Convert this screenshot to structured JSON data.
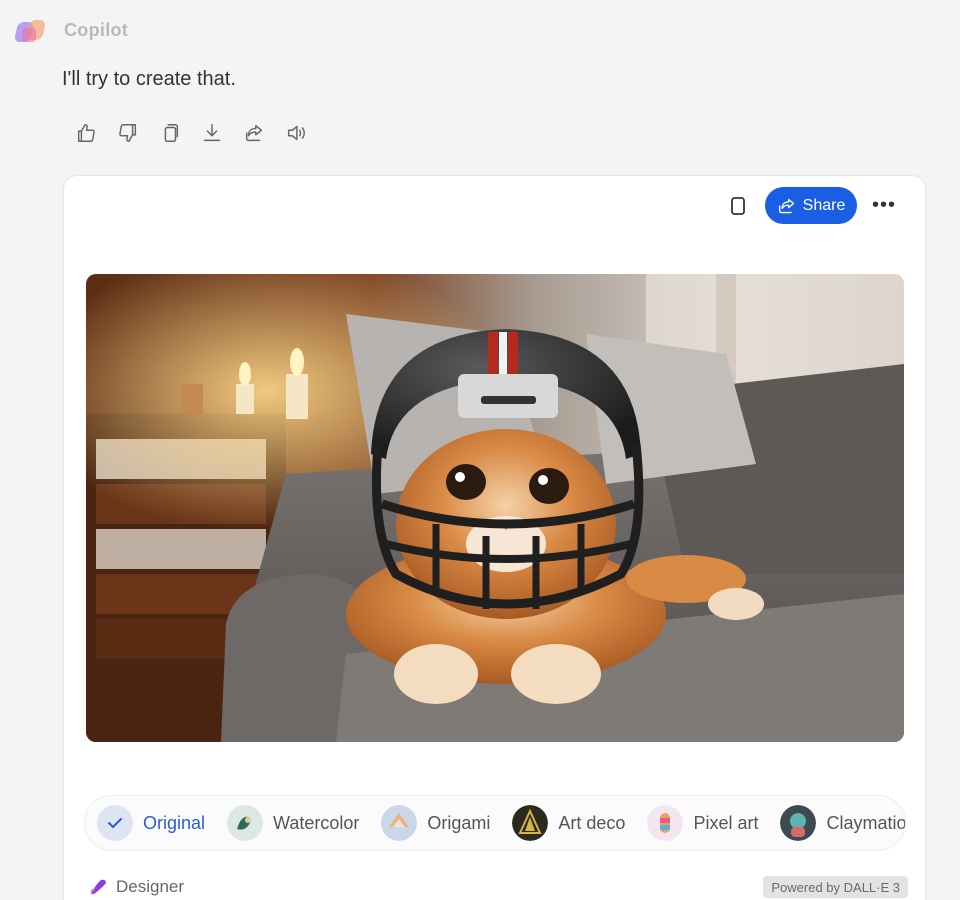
{
  "sender": {
    "name": "Copilot",
    "logo_icon": "copilot-logo-icon"
  },
  "message": {
    "text": "I'll try to create that."
  },
  "message_actions": [
    {
      "name": "like-icon",
      "label": "Like"
    },
    {
      "name": "dislike-icon",
      "label": "Dislike"
    },
    {
      "name": "copy-icon",
      "label": "Copy"
    },
    {
      "name": "download-icon",
      "label": "Export"
    },
    {
      "name": "share-icon",
      "label": "Share"
    },
    {
      "name": "speaker-icon",
      "label": "Read aloud"
    }
  ],
  "card": {
    "share_label": "Share",
    "more_label": "•••",
    "image_alt": "Orange tabby cat wearing a black football helmet with red stripes, lying on a grey sofa"
  },
  "styles": [
    {
      "label": "Original",
      "selected": true,
      "icon": "check-icon"
    },
    {
      "label": "Watercolor",
      "selected": false,
      "icon": "watercolor-thumb"
    },
    {
      "label": "Origami",
      "selected": false,
      "icon": "origami-thumb"
    },
    {
      "label": "Art deco",
      "selected": false,
      "icon": "art-deco-thumb"
    },
    {
      "label": "Pixel art",
      "selected": false,
      "icon": "pixel-art-thumb"
    },
    {
      "label": "Claymation",
      "selected": false,
      "icon": "claymation-thumb"
    }
  ],
  "footer": {
    "designer_label": "Designer",
    "powered_by": "Powered by DALL·E 3"
  },
  "colors": {
    "accent": "#1a5fe3",
    "selected_text": "#2d5bd7",
    "background": "#f4f4f4"
  }
}
